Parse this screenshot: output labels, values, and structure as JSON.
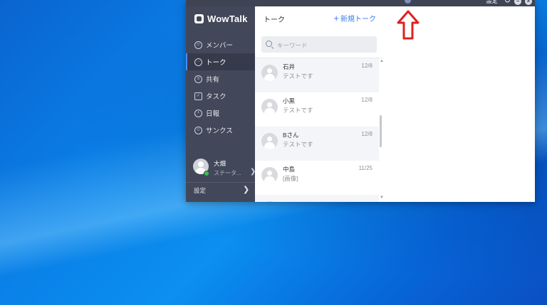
{
  "titlebar": {
    "settings_label": "設定",
    "refresh_icon": "refresh-icon",
    "minimize_icon": "minimize-icon",
    "close_icon": "close-icon"
  },
  "sidebar": {
    "app_name": "WowTalk",
    "items": [
      {
        "label": "メンバー",
        "icon": "member-icon"
      },
      {
        "label": "トーク",
        "icon": "talk-icon",
        "active": true
      },
      {
        "label": "共有",
        "icon": "share-icon"
      },
      {
        "label": "タスク",
        "icon": "task-icon"
      },
      {
        "label": "日報",
        "icon": "daily-report-icon"
      },
      {
        "label": "サンクス",
        "icon": "thanks-icon"
      }
    ],
    "profile": {
      "name": "大畑",
      "status": "ステータ...",
      "online": true
    },
    "settings_label": "設定"
  },
  "talk_list": {
    "title": "トーク",
    "new_talk_label": "新規トーク",
    "search_placeholder": "キーワード",
    "rows": [
      {
        "name": "石井",
        "message": "テストです",
        "date": "12/8"
      },
      {
        "name": "小黒",
        "message": "テストです",
        "date": "12/8"
      },
      {
        "name": "Bさん",
        "message": "テストです",
        "date": "12/8"
      },
      {
        "name": "中島",
        "message": "[画像]",
        "date": "11/25"
      },
      {
        "name": "",
        "message": "",
        "date": ""
      }
    ]
  },
  "annotation": {
    "arrow_color": "#e02020"
  },
  "colors": {
    "sidebar_bg": "#42485a",
    "accent": "#3a7ee9",
    "titlebar_bg": "#3f4455"
  }
}
